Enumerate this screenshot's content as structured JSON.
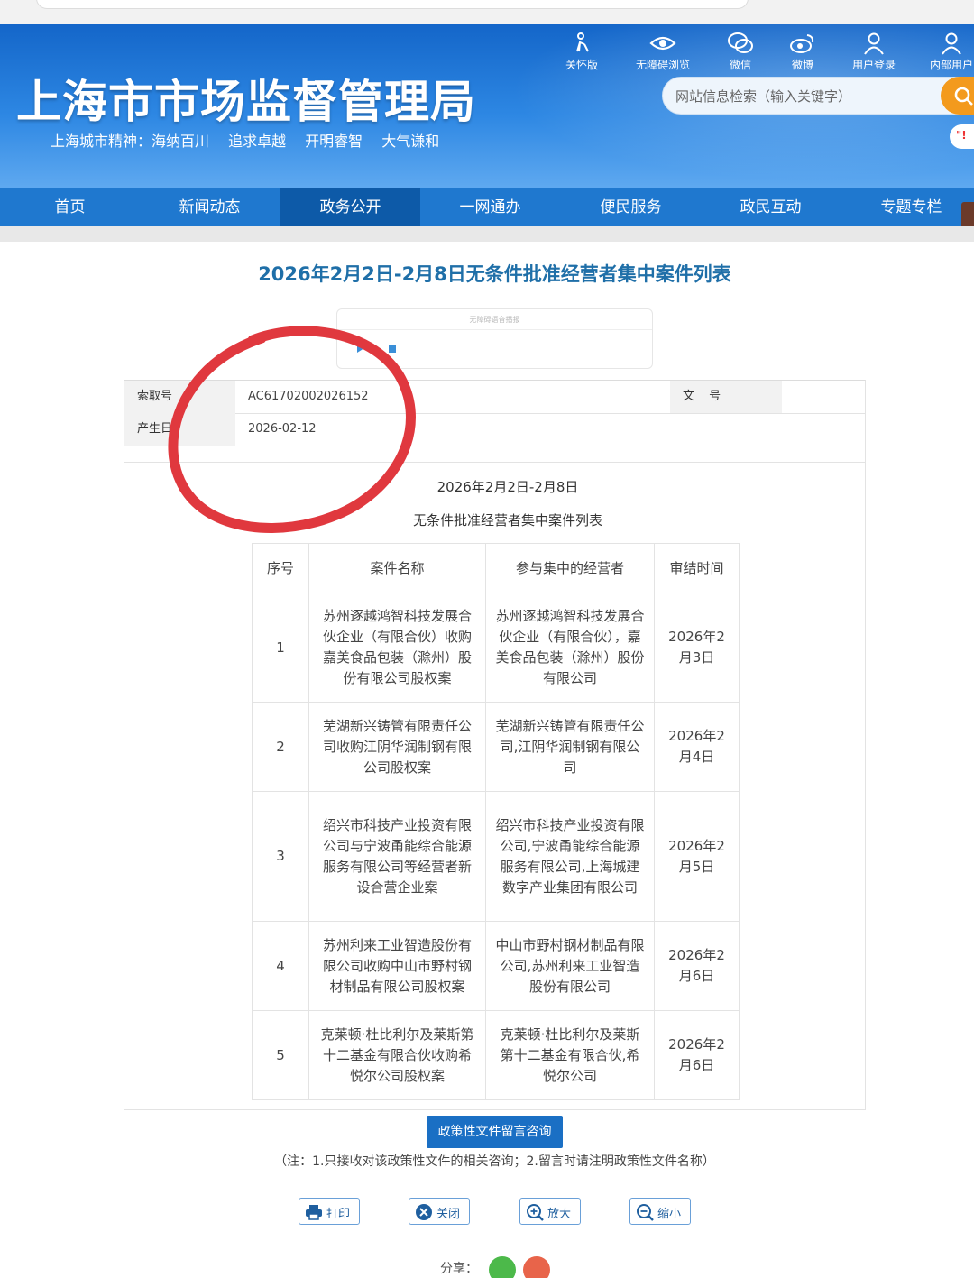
{
  "header": {
    "site_title": "上海市市场监督管理局",
    "slogan": "上海城市精神：海纳百川 追求卓越 开明睿智 大气谦和",
    "tools": [
      {
        "label": "关怀版",
        "icon": "elder-care-icon"
      },
      {
        "label": "无障碍浏览",
        "icon": "eye-icon"
      },
      {
        "label": "微信",
        "icon": "wechat-icon"
      },
      {
        "label": "微博",
        "icon": "weibo-icon"
      },
      {
        "label": "用户登录",
        "icon": "user-icon"
      },
      {
        "label": "内部用户",
        "icon": "user-icon"
      }
    ],
    "search_placeholder": "网站信息检索（输入关键字）",
    "badge": "\"!"
  },
  "nav": {
    "items": [
      "首页",
      "新闻动态",
      "政务公开",
      "一网通办",
      "便民服务",
      "政民互动",
      "专题专栏"
    ],
    "active": "政务公开"
  },
  "page_title": "2026年2月2日-2月8日无条件批准经营者集中案件列表",
  "player": {
    "label": "无障碍语音播报"
  },
  "meta": {
    "index_key": "索取号",
    "index_value": "AC61702002026152",
    "docno_key": "文 号",
    "date_key": "产生日",
    "date_value": "2026-02-12"
  },
  "doc": {
    "heading1": "2026年2月2日-2月8日",
    "heading2": "无条件批准经营者集中案件列表",
    "columns": [
      "序号",
      "案件名称",
      "参与集中的经营者",
      "审结时间"
    ],
    "rows": [
      {
        "no": "1",
        "name": "苏州逐越鸿智科技发展合伙企业（有限合伙）收购嘉美食品包装（滁州）股份有限公司股权案",
        "parties": "苏州逐越鸿智科技发展合伙企业（有限合伙），嘉美食品包装（滁州）股份有限公司",
        "date": "2026年2月3日"
      },
      {
        "no": "2",
        "name": "芜湖新兴铸管有限责任公司收购江阴华润制钢有限公司股权案",
        "parties": "芜湖新兴铸管有限责任公司,江阴华润制钢有限公司",
        "date": "2026年2月4日"
      },
      {
        "no": "3",
        "name": "绍兴市科技产业投资有限公司与宁波甬能综合能源服务有限公司等经营者新设合营企业案",
        "parties": "绍兴市科技产业投资有限公司,宁波甬能综合能源服务有限公司,上海城建数字产业集团有限公司",
        "date": "2026年2月5日"
      },
      {
        "no": "4",
        "name": "苏州利来工业智造股份有限公司收购中山市野村钢材制品有限公司股权案",
        "parties": "中山市野村钢材制品有限公司,苏州利来工业智造股份有限公司",
        "date": "2026年2月6日"
      },
      {
        "no": "5",
        "name": "克莱顿·杜比利尔及莱斯第十二基金有限合伙收购希悦尔公司股权案",
        "parties": "克莱顿·杜比利尔及莱斯第十二基金有限合伙,希悦尔公司",
        "date": "2026年2月6日"
      }
    ]
  },
  "footer": {
    "consult_label": "政策性文件留言咨询",
    "note": "（注：1.只接收对该政策性文件的相关咨询；2.留言时请注明政策性文件名称）",
    "print": "打印",
    "close": "关闭",
    "zoom_in": "放大",
    "zoom_out": "缩小",
    "share": "分享："
  },
  "colors": {
    "brand_blue": "#1f78cf",
    "nav_active": "#0d5aa8",
    "title_blue": "#1f6fa8",
    "search_orange": "#f39a1d",
    "annotation_red": "#e0383e"
  }
}
